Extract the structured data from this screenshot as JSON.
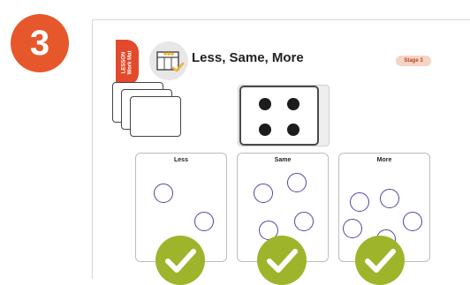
{
  "step_number": "3",
  "tab_text": "LESSON\nWork Mat",
  "title": "Less, Same, More",
  "stage_badge": "Stage 3",
  "boxes": [
    {
      "label": "Less"
    },
    {
      "label": "Same"
    },
    {
      "label": "More"
    }
  ],
  "colors": {
    "step_badge": "#e6582b",
    "tab": "#e24a2b",
    "ring": "#5444a3",
    "check": "#9eb52b",
    "stage_badge_bg": "#f7d4c6"
  },
  "icons": [
    "work-mat-icon",
    "checkmark-icon"
  ]
}
